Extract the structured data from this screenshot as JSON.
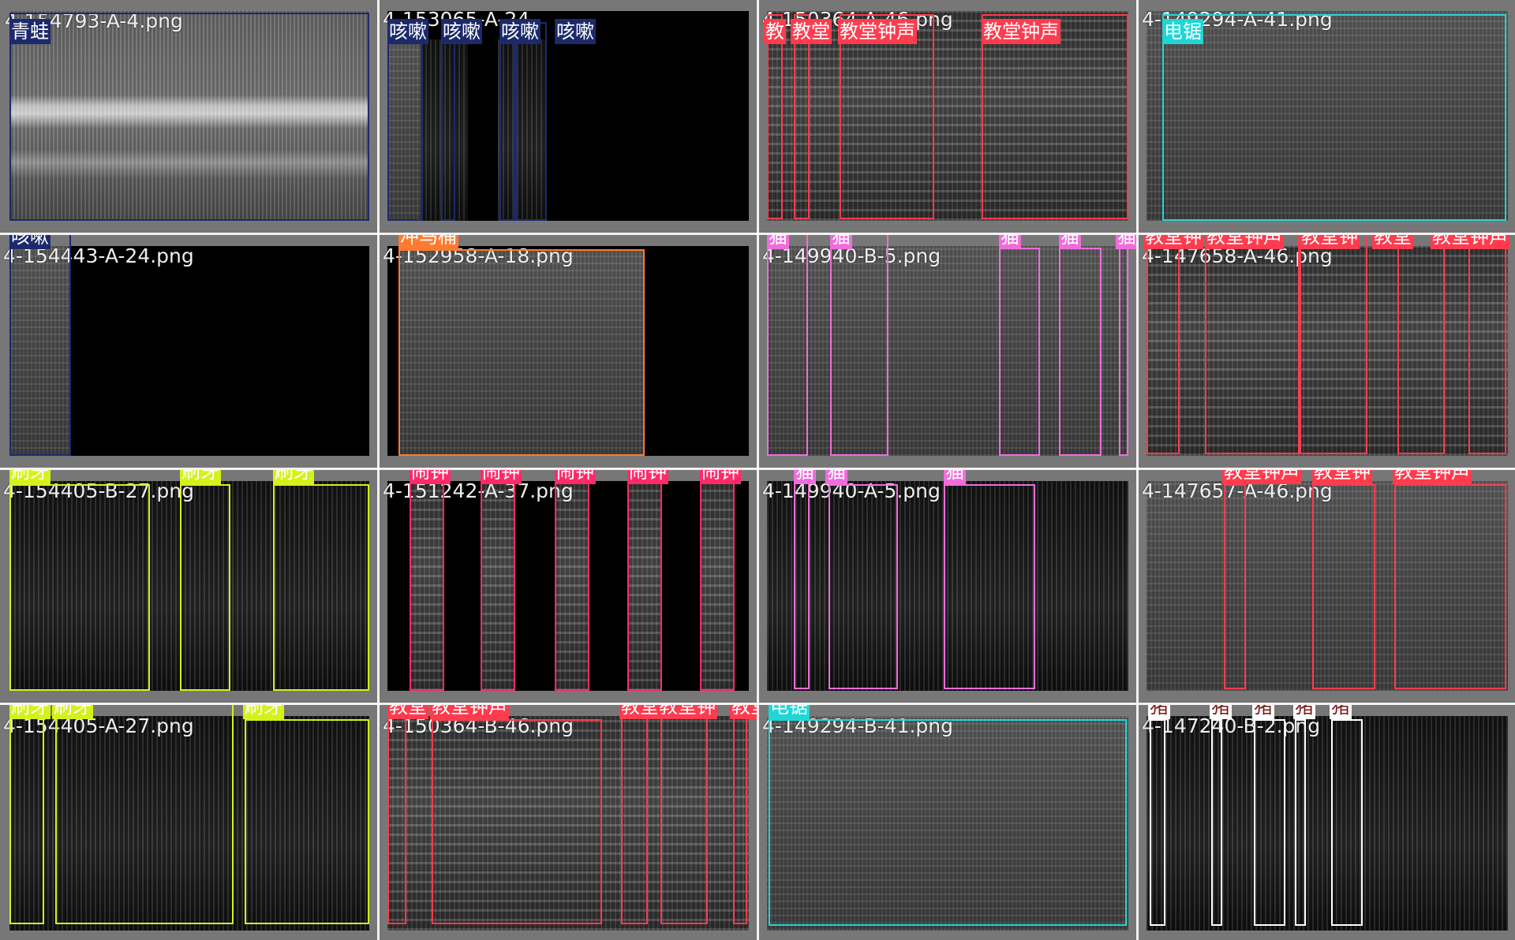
{
  "colors": {
    "frog": "#1c2a6b",
    "cough": "#1c2a6b",
    "church_bells": "#ff3b4e",
    "chainsaw": "#1fd6d6",
    "toilet_flush": "#ff7a2e",
    "cat": "#f06ddb",
    "brushing_teeth": "#d4f21a",
    "clock_alarm": "#ff2a6a",
    "pig": "#ffffff"
  },
  "tiles": [
    {
      "filename": "4-154793-A-4.png",
      "labels": [
        "青蛙"
      ]
    },
    {
      "filename": "4-153065-A-24",
      "labels": [
        "咳嗽",
        "咳嗽",
        "咳嗽",
        "咳嗽"
      ]
    },
    {
      "filename": "4-150364-A-46.png",
      "labels": [
        "教",
        "教堂",
        "教堂钟声",
        "教堂钟声"
      ]
    },
    {
      "filename": "4-149294-A-41.png",
      "labels": [
        "电锯"
      ]
    },
    {
      "filename": "4-154443-A-24.png",
      "labels": [
        "咳嗽"
      ]
    },
    {
      "filename": "4-152958-A-18.png",
      "labels": [
        "冲马桶"
      ]
    },
    {
      "filename": "4-149940-B-5.png",
      "labels": [
        "猫",
        "猫",
        "猫",
        "猫",
        "猫"
      ]
    },
    {
      "filename": "4-147658-A-46.png",
      "labels": [
        "教堂钟",
        "教堂钟声",
        "教堂钟",
        "教堂",
        "教堂钟声"
      ]
    },
    {
      "filename": "4-154405-B-27.png",
      "labels": [
        "刷牙",
        "刷牙",
        "刷牙"
      ]
    },
    {
      "filename": "4-151242-A-37.png",
      "labels": [
        "闹钟",
        "闹钟",
        "闹钟",
        "闹钟",
        "闹钟"
      ]
    },
    {
      "filename": "4-149940-A-5.png",
      "labels": [
        "猫",
        "猫",
        "猫"
      ]
    },
    {
      "filename": "4-147657-A-46.png",
      "labels": [
        "教堂钟声",
        "教堂钟",
        "教堂钟声"
      ]
    },
    {
      "filename": "4-154405-A-27.png",
      "labels": [
        "刷牙",
        "刷牙",
        "刷牙"
      ]
    },
    {
      "filename": "4-150364-B-46.png",
      "labels": [
        "教堂",
        "教堂钟声",
        "教堂",
        "教堂钟",
        "教堂"
      ]
    },
    {
      "filename": "4-149294-B-41.png",
      "labels": [
        "电锯"
      ]
    },
    {
      "filename": "4-147240-B-2.png",
      "labels": [
        "猪",
        "猪",
        "猪",
        "猪",
        "猪"
      ]
    }
  ]
}
